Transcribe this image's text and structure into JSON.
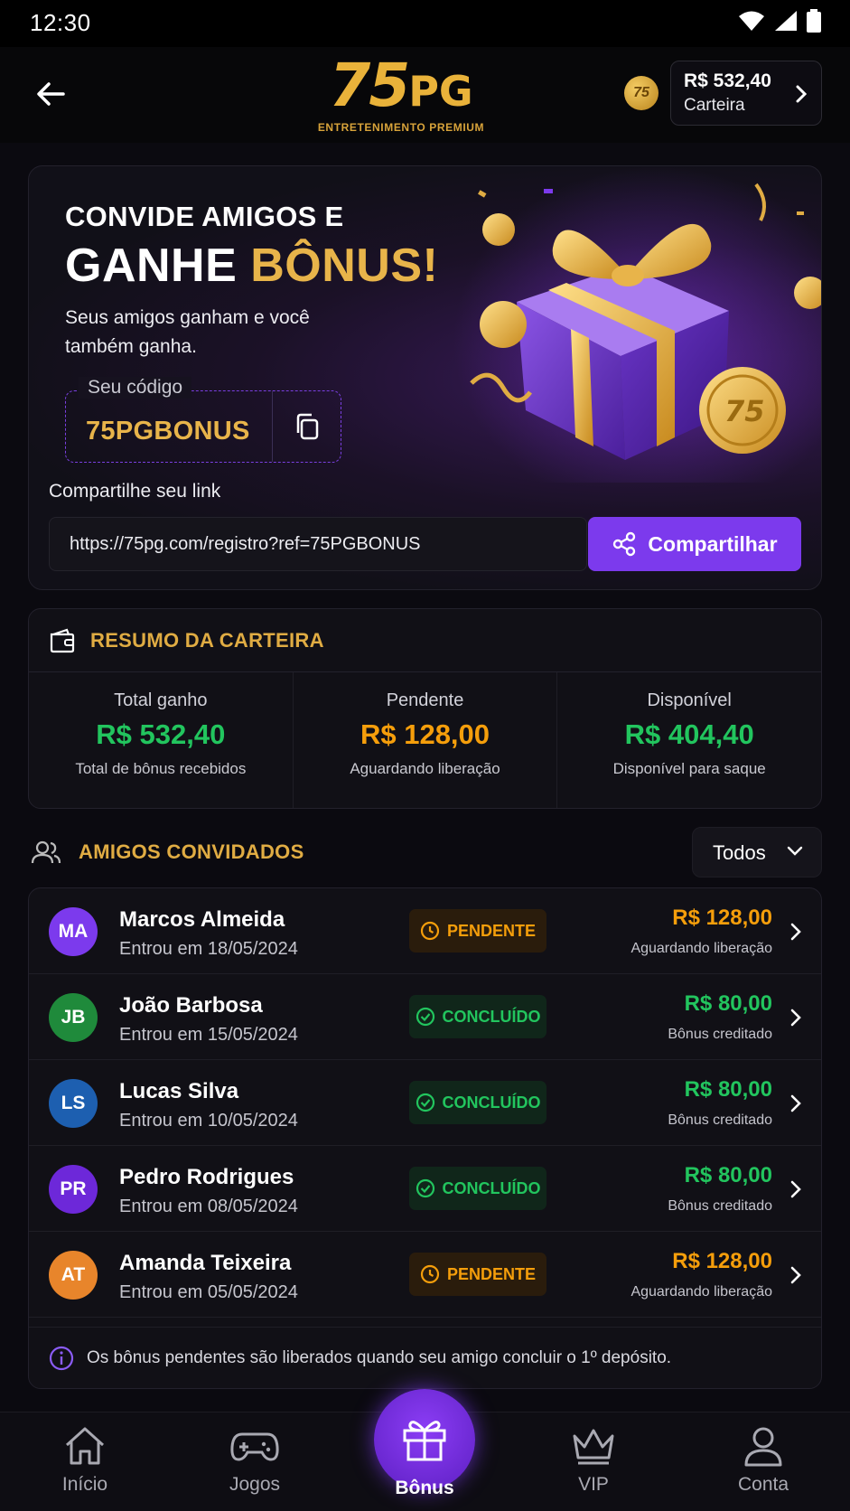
{
  "status_bar": {
    "time": "12:30"
  },
  "header": {
    "logo_main": "75",
    "logo_pg": "PG",
    "logo_tagline": "ENTRETENIMENTO PREMIUM",
    "coin_label": "75",
    "balance": "R$ 532,40",
    "wallet_label": "Carteira"
  },
  "hero": {
    "line1": "CONVIDE AMIGOS E",
    "line2_white": "GANHE ",
    "line2_gold": "BÔNUS!",
    "subtitle": "Seus amigos ganham e você também ganha.",
    "code_label": "Seu código",
    "code_value": "75PGBONUS",
    "share_label": "Compartilhe seu link",
    "share_link": "https://75pg.com/registro?ref=75PGBONUS",
    "share_button": "Compartilhar"
  },
  "summary": {
    "title": "RESUMO DA CARTEIRA",
    "columns": [
      {
        "label": "Total ganho",
        "value": "R$ 532,40",
        "desc": "Total de bônus recebidos",
        "color": "green"
      },
      {
        "label": "Pendente",
        "value": "R$ 128,00",
        "desc": "Aguardando liberação",
        "color": "orange"
      },
      {
        "label": "Disponível",
        "value": "R$ 404,40",
        "desc": "Disponível para saque",
        "color": "green"
      }
    ]
  },
  "friends": {
    "title": "AMIGOS CONVIDADOS",
    "filter": "Todos",
    "rows": [
      {
        "initials": "MA",
        "avatar_color": "#7c3aed",
        "name": "Marcos Almeida",
        "date": "Entrou em 18/05/2024",
        "status": "PENDENTE",
        "status_type": "pend",
        "amount": "R$ 128,00",
        "amount_desc": "Aguardando liberação"
      },
      {
        "initials": "JB",
        "avatar_color": "#1f8a3b",
        "name": "João Barbosa",
        "date": "Entrou em 15/05/2024",
        "status": "CONCLUÍDO",
        "status_type": "done",
        "amount": "R$ 80,00",
        "amount_desc": "Bônus creditado"
      },
      {
        "initials": "LS",
        "avatar_color": "#1d5fb0",
        "name": "Lucas Silva",
        "date": "Entrou em 10/05/2024",
        "status": "CONCLUÍDO",
        "status_type": "done",
        "amount": "R$ 80,00",
        "amount_desc": "Bônus creditado"
      },
      {
        "initials": "PR",
        "avatar_color": "#6d28d9",
        "name": "Pedro Rodrigues",
        "date": "Entrou em 08/05/2024",
        "status": "CONCLUÍDO",
        "status_type": "done",
        "amount": "R$ 80,00",
        "amount_desc": "Bônus creditado"
      },
      {
        "initials": "AT",
        "avatar_color": "#e8852b",
        "name": "Amanda Teixeira",
        "date": "Entrou em 05/05/2024",
        "status": "PENDENTE",
        "status_type": "pend",
        "amount": "R$ 128,00",
        "amount_desc": "Aguardando liberação"
      }
    ],
    "info": "Os bônus pendentes são liberados quando seu amigo concluir o 1º depósito."
  },
  "nav": {
    "items": [
      {
        "label": "Início",
        "icon": "home-icon"
      },
      {
        "label": "Jogos",
        "icon": "gamepad-icon"
      },
      {
        "label": "Bônus",
        "icon": "gift-icon",
        "active": true
      },
      {
        "label": "VIP",
        "icon": "crown-icon"
      },
      {
        "label": "Conta",
        "icon": "user-icon"
      }
    ]
  },
  "colors": {
    "accent": "#7c3aed",
    "gold": "#e0ac43",
    "green": "#22c55e",
    "orange": "#f59e0b"
  }
}
